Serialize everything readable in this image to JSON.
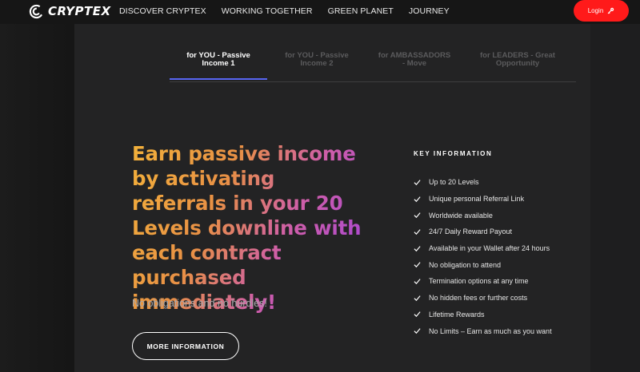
{
  "header": {
    "logo_text": "CRYPTEX",
    "nav": [
      "DISCOVER CRYPTEX",
      "WORKING TOGETHER",
      "GREEN PLANET",
      "JOURNEY"
    ],
    "login_label": "Login",
    "login_color": "#ff1a1a"
  },
  "tabs": [
    {
      "label": "for YOU - Passive Income 1",
      "active": true
    },
    {
      "label": "for YOU - Passive Income 2",
      "active": false
    },
    {
      "label": "for AMBASSADORS - Move",
      "active": false
    },
    {
      "label": "for LEADERS - Great Opportunity",
      "active": false
    }
  ],
  "main": {
    "headline": "Earn passive income by activating referrals in your 20 Levels downline with each contract purchased immediately!",
    "subtext": "No obligations and no hurdles!",
    "more_button": "MORE INFORMATION"
  },
  "key_info": {
    "title": "KEY INFORMATION",
    "items": [
      "Up to 20 Levels",
      "Unique personal Referral Link",
      "Worldwide available",
      "24/7 Daily Reward Payout",
      "Available in your Wallet after 24 hours",
      "No obligation to attend",
      "Termination options at any time",
      "No hidden fees or further costs",
      "Lifetime Rewards",
      "No Limits – Earn as much as you want"
    ]
  },
  "colors": {
    "accent_underline": "#5865f2",
    "gradient_start": "#f3b23a",
    "gradient_end": "#9b3fe3"
  }
}
